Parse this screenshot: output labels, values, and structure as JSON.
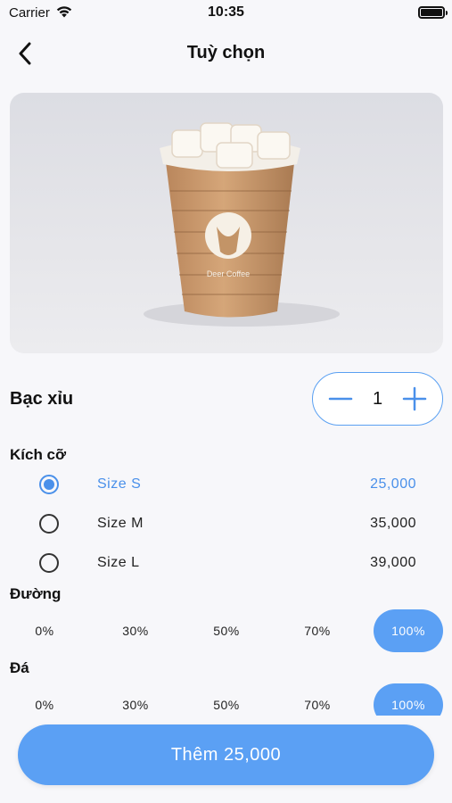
{
  "status_bar": {
    "carrier": "Carrier",
    "time": "10:35"
  },
  "nav": {
    "title": "Tuỳ chọn"
  },
  "product": {
    "name": "Bạc xỉu",
    "image_icon": "iced-coffee-cup-image",
    "cup_logo_text": "Deer Coffee"
  },
  "quantity": {
    "value": "1"
  },
  "size_section": {
    "label": "Kích cỡ",
    "options": [
      {
        "name": "Size S",
        "price": "25,000",
        "selected": true
      },
      {
        "name": "Size M",
        "price": "35,000",
        "selected": false
      },
      {
        "name": "Size L",
        "price": "39,000",
        "selected": false
      }
    ]
  },
  "sugar_section": {
    "label": "Đường",
    "options": [
      "0%",
      "30%",
      "50%",
      "70%",
      "100%"
    ],
    "selected": "100%"
  },
  "ice_section": {
    "label": "Đá",
    "options": [
      "0%",
      "30%",
      "50%",
      "70%",
      "100%"
    ],
    "selected": "100%"
  },
  "add_button": {
    "label": "Thêm 25,000"
  },
  "colors": {
    "accent": "#5ba0f4",
    "selected_text": "#4a90ea"
  }
}
